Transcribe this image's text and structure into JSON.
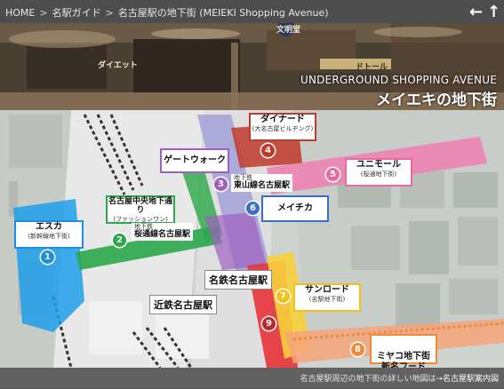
{
  "breadcrumb": {
    "items": [
      "HOME",
      "名駅ガイド",
      "名古屋駅の地下街 (MEIEKI Shopping Avenue)"
    ],
    "separator": ">"
  },
  "nav": {
    "back_icon": "←",
    "up_icon": "↑"
  },
  "hero": {
    "title_en": "UNDERGROUND SHOPPING AVENUE",
    "title_ja": "メイエキの地下街",
    "signs": [
      "文明堂",
      "ドトール",
      "ダイエット"
    ]
  },
  "malls": [
    {
      "num": "1",
      "name": "エスカ",
      "sub": "(新幹線地下街)",
      "color": "#1e8ee0"
    },
    {
      "num": "2",
      "name": "名古屋中央地下通り",
      "sub": "(ファッションワン)",
      "color": "#2aa84a"
    },
    {
      "num": "3",
      "name": "ゲートウォーク",
      "sub": "",
      "color": "#a060c0"
    },
    {
      "num": "4",
      "name": "ダイナード",
      "sub": "(大名古屋ビルヂング)",
      "color": "#c03a2b"
    },
    {
      "num": "5",
      "name": "ユニモール",
      "sub": "(桜通地下街)",
      "color": "#e86aa0"
    },
    {
      "num": "6",
      "name": "メイチカ",
      "sub": "",
      "color": "#3a6ec8"
    },
    {
      "num": "7",
      "name": "サンロード",
      "sub": "(名駅地下街)",
      "color": "#f2c21a"
    },
    {
      "num": "8",
      "name": "ミヤコ地下街\n新名フード",
      "sub": "",
      "color": "#f08a3a"
    },
    {
      "num": "9",
      "name": "",
      "sub": "",
      "color": "#b82828"
    }
  ],
  "stations": {
    "meitetsu": "名鉄名古屋駅",
    "kintetsu": "近鉄名古屋駅",
    "subway_sakuradori": {
      "line1": "地下鉄",
      "line2": "桜通線名古屋駅"
    },
    "subway_higashiyama": {
      "line1": "地下鉄",
      "line2": "東山線名古屋駅"
    }
  },
  "footer": {
    "text": "名古屋駅周辺の地下街の詳しい地図は→",
    "link": "名古屋駅案内図"
  }
}
